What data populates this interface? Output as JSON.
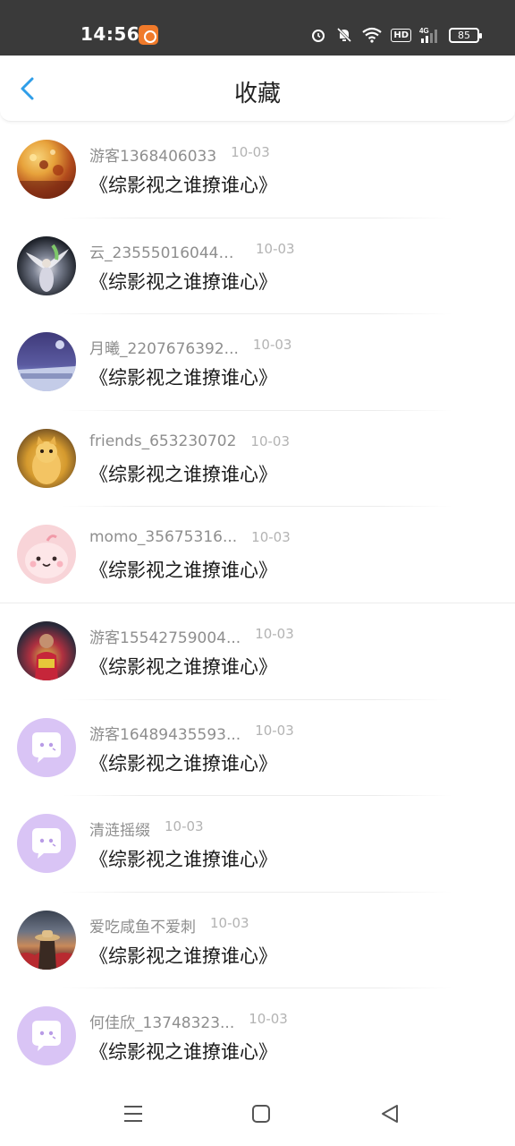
{
  "status_bar": {
    "time": "14:56",
    "battery": "85",
    "network": "4G",
    "hd": "HD",
    "icons": [
      "app-icon",
      "alarm-icon",
      "mute-bell-icon",
      "wifi-icon",
      "hd-icon",
      "signal-icon",
      "battery-icon"
    ]
  },
  "header": {
    "back_icon": "chevron-left-icon",
    "title": "收藏"
  },
  "items": [
    {
      "name": "游客1368406033",
      "date": "10-03",
      "title": "《综影视之谁撩谁心》",
      "avatar": "flower"
    },
    {
      "name": "云_235550160446...",
      "date": "10-03",
      "title": "《综影视之谁撩谁心》",
      "avatar": "angel"
    },
    {
      "name": "月曦_2207676392...",
      "date": "10-03",
      "title": "《综影视之谁撩谁心》",
      "avatar": "moon"
    },
    {
      "name": "friends_653230702",
      "date": "10-03",
      "title": "《综影视之谁撩谁心》",
      "avatar": "cat"
    },
    {
      "name": "momo_35675316...",
      "date": "10-03",
      "title": "《综影视之谁撩谁心》",
      "avatar": "pink-creature"
    },
    {
      "name": "游客15542759004...",
      "date": "10-03",
      "title": "《综影视之谁撩谁心》",
      "avatar": "person"
    },
    {
      "name": "游客16489435593...",
      "date": "10-03",
      "title": "《综影视之谁撩谁心》",
      "avatar": "default-chat"
    },
    {
      "name": "清涟摇缀",
      "date": "10-03",
      "title": "《综影视之谁撩谁心》",
      "avatar": "default-chat"
    },
    {
      "name": "爱吃咸鱼不爱刺",
      "date": "10-03",
      "title": "《综影视之谁撩谁心》",
      "avatar": "hat-person"
    },
    {
      "name": "何佳欣_13748323...",
      "date": "10-03",
      "title": "《综影视之谁撩谁心》",
      "avatar": "default-chat"
    }
  ],
  "nav_bar": {
    "icons": [
      "menu-icon",
      "home-icon",
      "back-icon"
    ]
  },
  "colors": {
    "accent": "#2f9ee8",
    "default_avatar": "#d9c4f5",
    "meta_text": "#8e8e8e"
  }
}
